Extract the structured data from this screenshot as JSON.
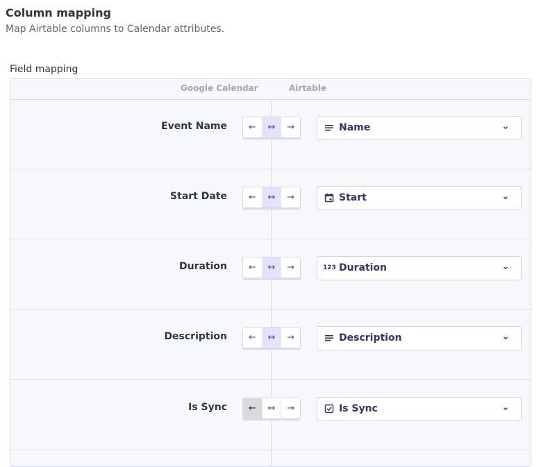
{
  "header": {
    "title": "Column mapping",
    "subtitle": "Map Airtable columns to Calendar attributes."
  },
  "section": {
    "label": "Field mapping"
  },
  "columns": {
    "left": "Google Calendar",
    "right": "Airtable"
  },
  "directions": {
    "to_left": "←",
    "both": "↔",
    "to_right": "→"
  },
  "rows": [
    {
      "calendar_field": "Event Name",
      "direction": "both",
      "airtable_field": "Name",
      "type_icon": "long-text-icon"
    },
    {
      "calendar_field": "Start Date",
      "direction": "both",
      "airtable_field": "Start",
      "type_icon": "calendar-icon"
    },
    {
      "calendar_field": "Duration",
      "direction": "both",
      "airtable_field": "Duration",
      "type_icon": "number-icon"
    },
    {
      "calendar_field": "Description",
      "direction": "both",
      "airtable_field": "Description",
      "type_icon": "long-text-icon"
    },
    {
      "calendar_field": "Is Sync",
      "direction": "to_left",
      "airtable_field": "Is Sync",
      "type_icon": "checkbox-icon"
    }
  ],
  "number_icon_text": "123",
  "colors": {
    "accent": "#4b48c9",
    "panel_bg": "#f7f8fc",
    "border": "#d9dcf1"
  }
}
